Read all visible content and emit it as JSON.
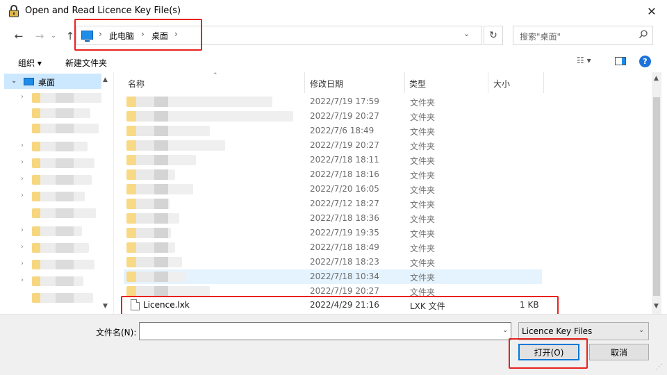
{
  "window": {
    "title": "Open and Read Licence Key File(s)",
    "close_glyph": "✕"
  },
  "nav": {
    "back": "←",
    "forward": "→",
    "recent": "⌄",
    "up": "↑",
    "breadcrumbs": [
      "此电脑",
      "桌面"
    ],
    "sep": "›",
    "dropdown": "⌄",
    "refresh": "↻"
  },
  "search": {
    "placeholder": "搜索\"桌面\"",
    "icon": "search-icon"
  },
  "toolbar": {
    "organize": "组织 ▾",
    "new_folder": "新建文件夹",
    "view": "☷ ▾",
    "help": "?"
  },
  "navpane": {
    "selected": "桌面",
    "chevron_open": "⌄",
    "chevron_closed": "›"
  },
  "columns": {
    "name": "名称",
    "date": "修改日期",
    "type": "类型",
    "size": "大小"
  },
  "rows": [
    {
      "date": "2022/7/19 17:59",
      "type": "文件夹"
    },
    {
      "date": "2022/7/19 20:27",
      "type": "文件夹"
    },
    {
      "date": "2022/7/6 18:49",
      "type": "文件夹"
    },
    {
      "date": "2022/7/19 20:27",
      "type": "文件夹"
    },
    {
      "date": "2022/7/18 18:11",
      "type": "文件夹"
    },
    {
      "date": "2022/7/18 18:16",
      "type": "文件夹"
    },
    {
      "date": "2022/7/20 16:05",
      "type": "文件夹"
    },
    {
      "date": "2022/7/12 18:27",
      "type": "文件夹"
    },
    {
      "date": "2022/7/18 18:36",
      "type": "文件夹"
    },
    {
      "date": "2022/7/19 19:35",
      "type": "文件夹"
    },
    {
      "date": "2022/7/18 18:49",
      "type": "文件夹"
    },
    {
      "date": "2022/7/18 18:23",
      "type": "文件夹"
    },
    {
      "date": "2022/7/18 10:34",
      "type": "文件夹"
    },
    {
      "date": "2022/7/19 20:27",
      "type": "文件夹"
    }
  ],
  "licence_file": {
    "name": "Licence.lxk",
    "date": "2022/4/29 21:16",
    "type": "LXK 文件",
    "size": "1 KB"
  },
  "bottom": {
    "filename_label": "文件名(N):",
    "filename_value": "",
    "filetype": "Licence Key Files",
    "open": "打开(O)",
    "cancel": "取消"
  },
  "colors": {
    "highlight_red": "#e8221c",
    "selection_blue": "#cce8ff",
    "accent_blue": "#0078d7"
  }
}
